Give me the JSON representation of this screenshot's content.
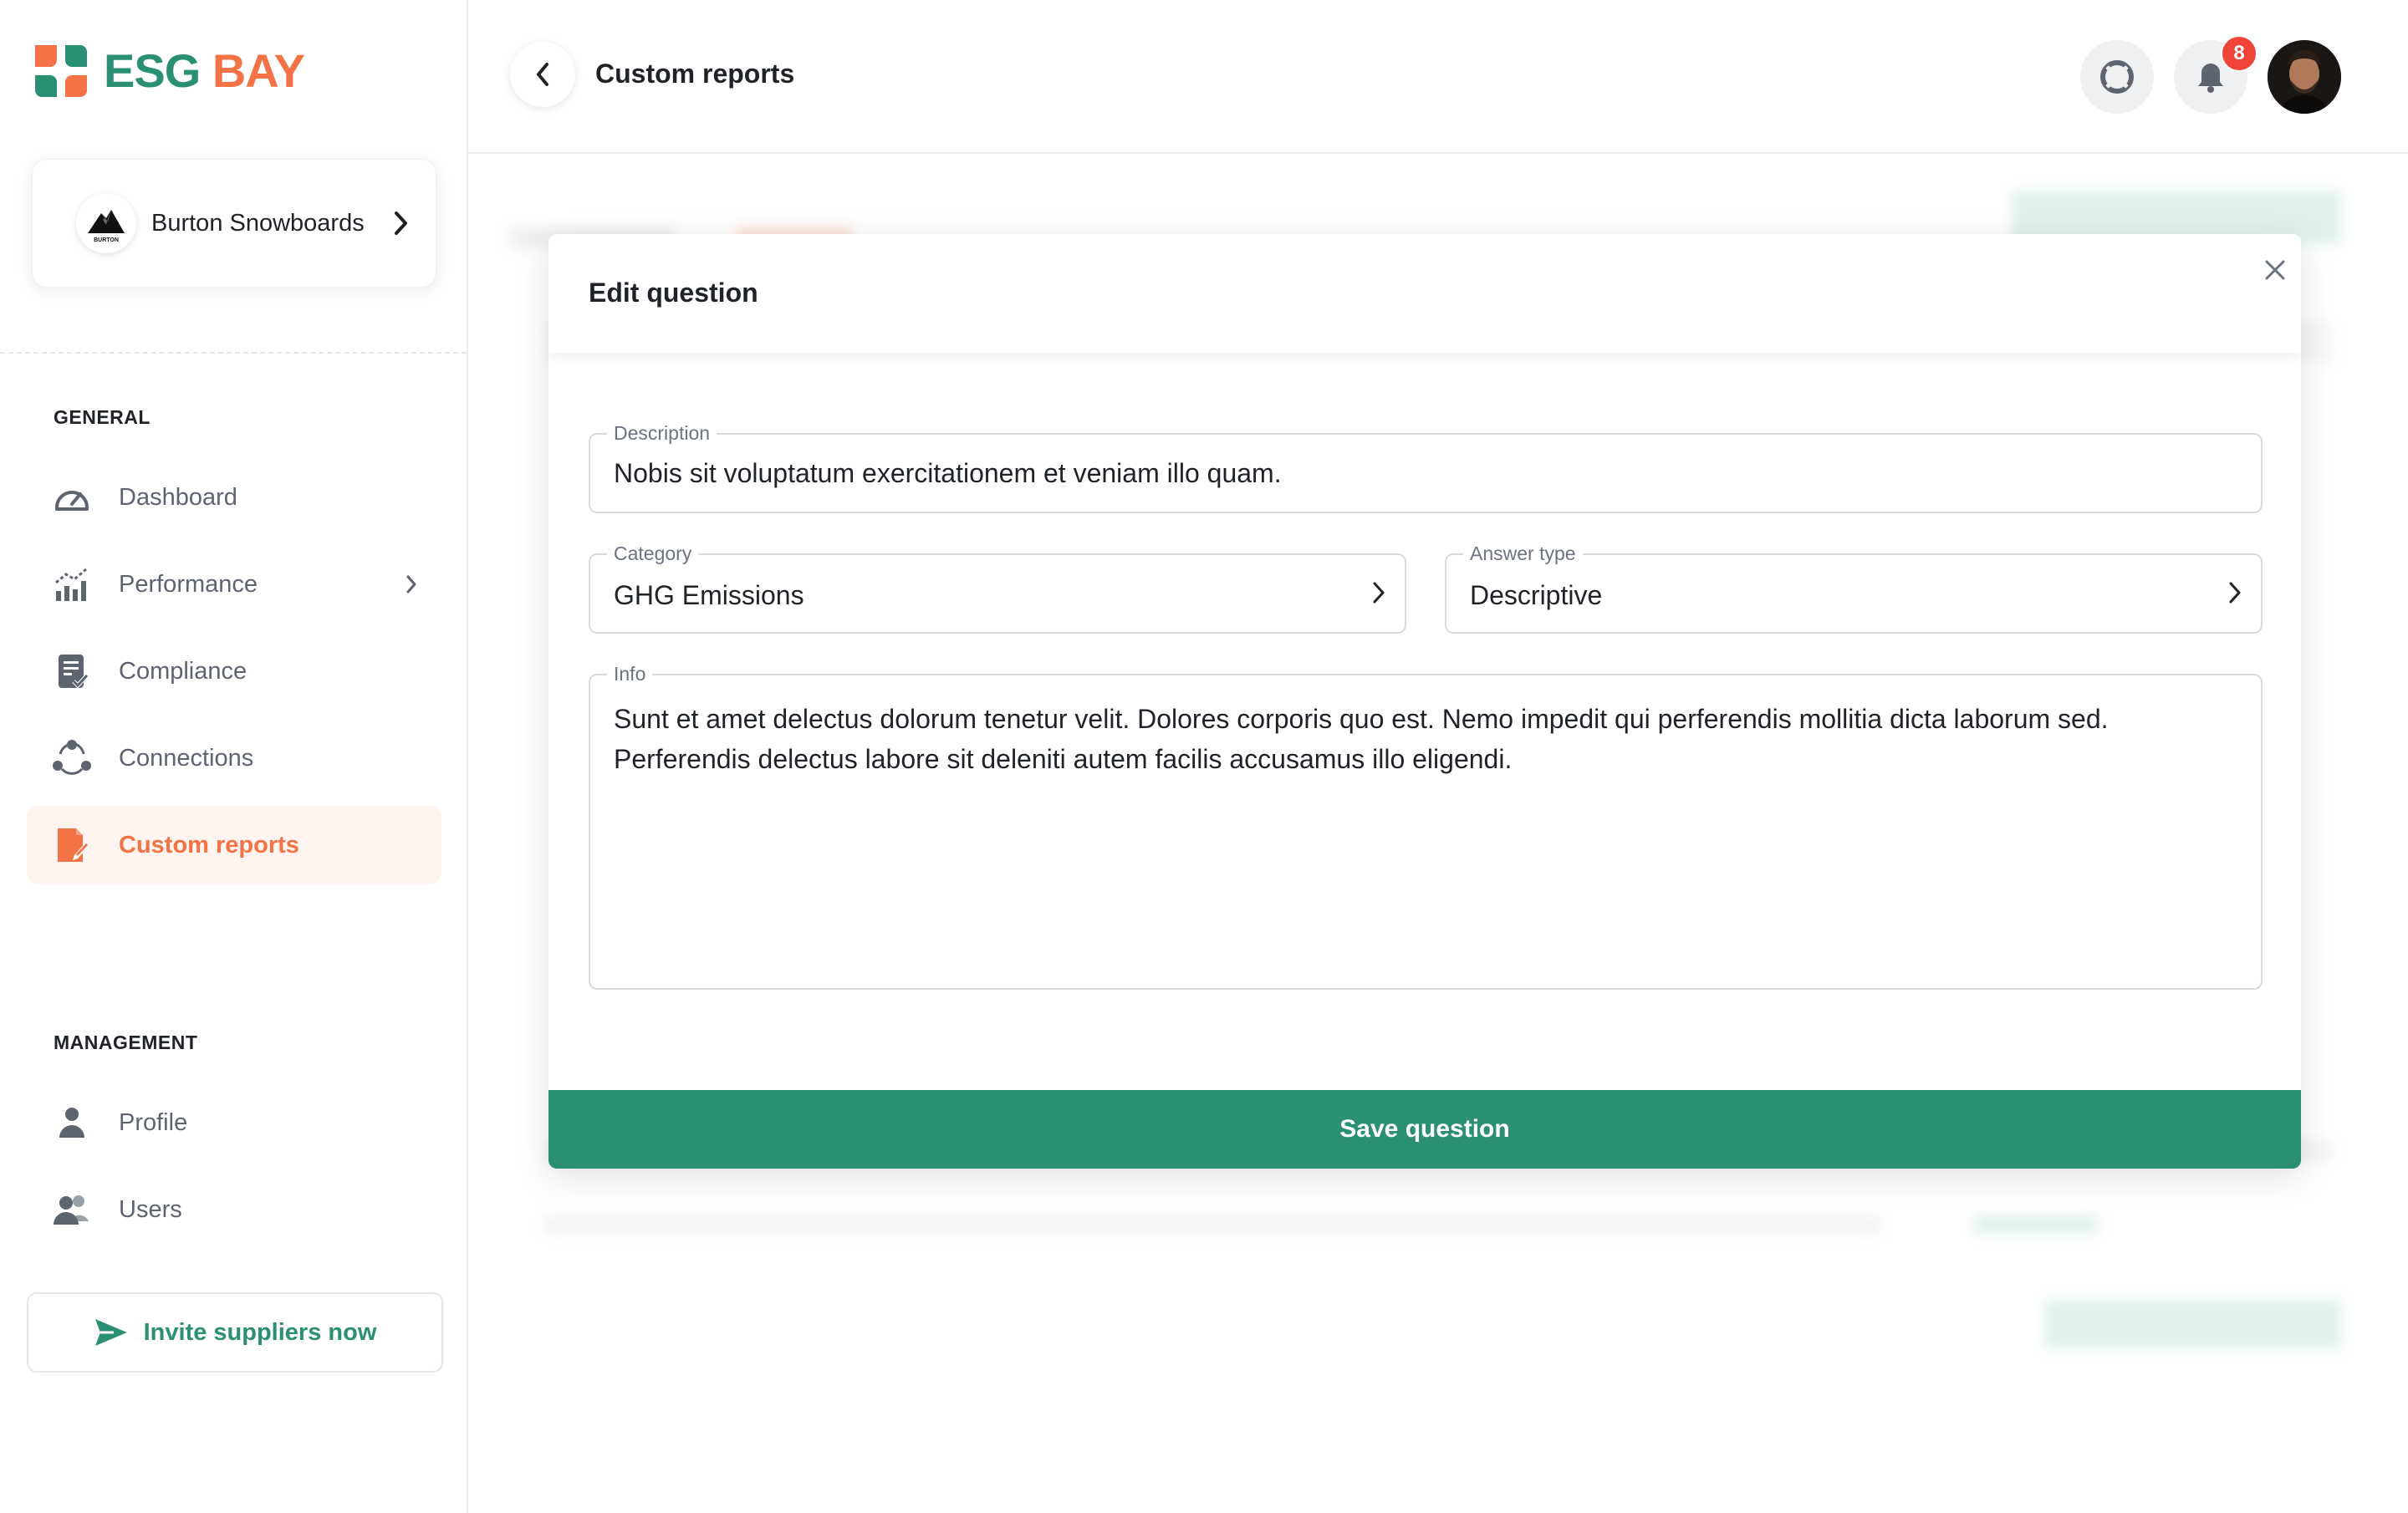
{
  "app": {
    "logo_part1": "ESG",
    "logo_part2": "BAY",
    "brand_green": "#2a8f73",
    "brand_orange": "#f47346"
  },
  "organization": {
    "name": "Burton Snowboards",
    "logo_text": "BURTON"
  },
  "sidebar": {
    "general_title": "GENERAL",
    "general_items": [
      {
        "label": "Dashboard",
        "icon": "gauge-icon"
      },
      {
        "label": "Performance",
        "icon": "chart-icon"
      },
      {
        "label": "Compliance",
        "icon": "clipboard-check-icon"
      },
      {
        "label": "Connections",
        "icon": "connections-icon"
      },
      {
        "label": "Custom reports",
        "icon": "document-edit-icon",
        "active": true
      }
    ],
    "management_title": "MANAGEMENT",
    "management_items": [
      {
        "label": "Profile",
        "icon": "user-icon"
      },
      {
        "label": "Users",
        "icon": "users-icon"
      }
    ],
    "invite_label": "Invite suppliers now"
  },
  "header": {
    "title": "Custom reports",
    "notification_count": "8"
  },
  "modal": {
    "title": "Edit question",
    "description_label": "Description",
    "description_value": "Nobis sit voluptatum exercitationem et veniam illo quam.",
    "category_label": "Category",
    "category_value": "GHG Emissions",
    "answer_type_label": "Answer type",
    "answer_type_value": "Descriptive",
    "info_label": "Info",
    "info_value": "Sunt et amet delectus dolorum tenetur velit. Dolores corporis quo est. Nemo impedit qui perferendis mollitia dicta laborum sed. Perferendis delectus labore sit deleniti autem facilis accusamus illo eligendi.",
    "save_label": "Save question"
  }
}
